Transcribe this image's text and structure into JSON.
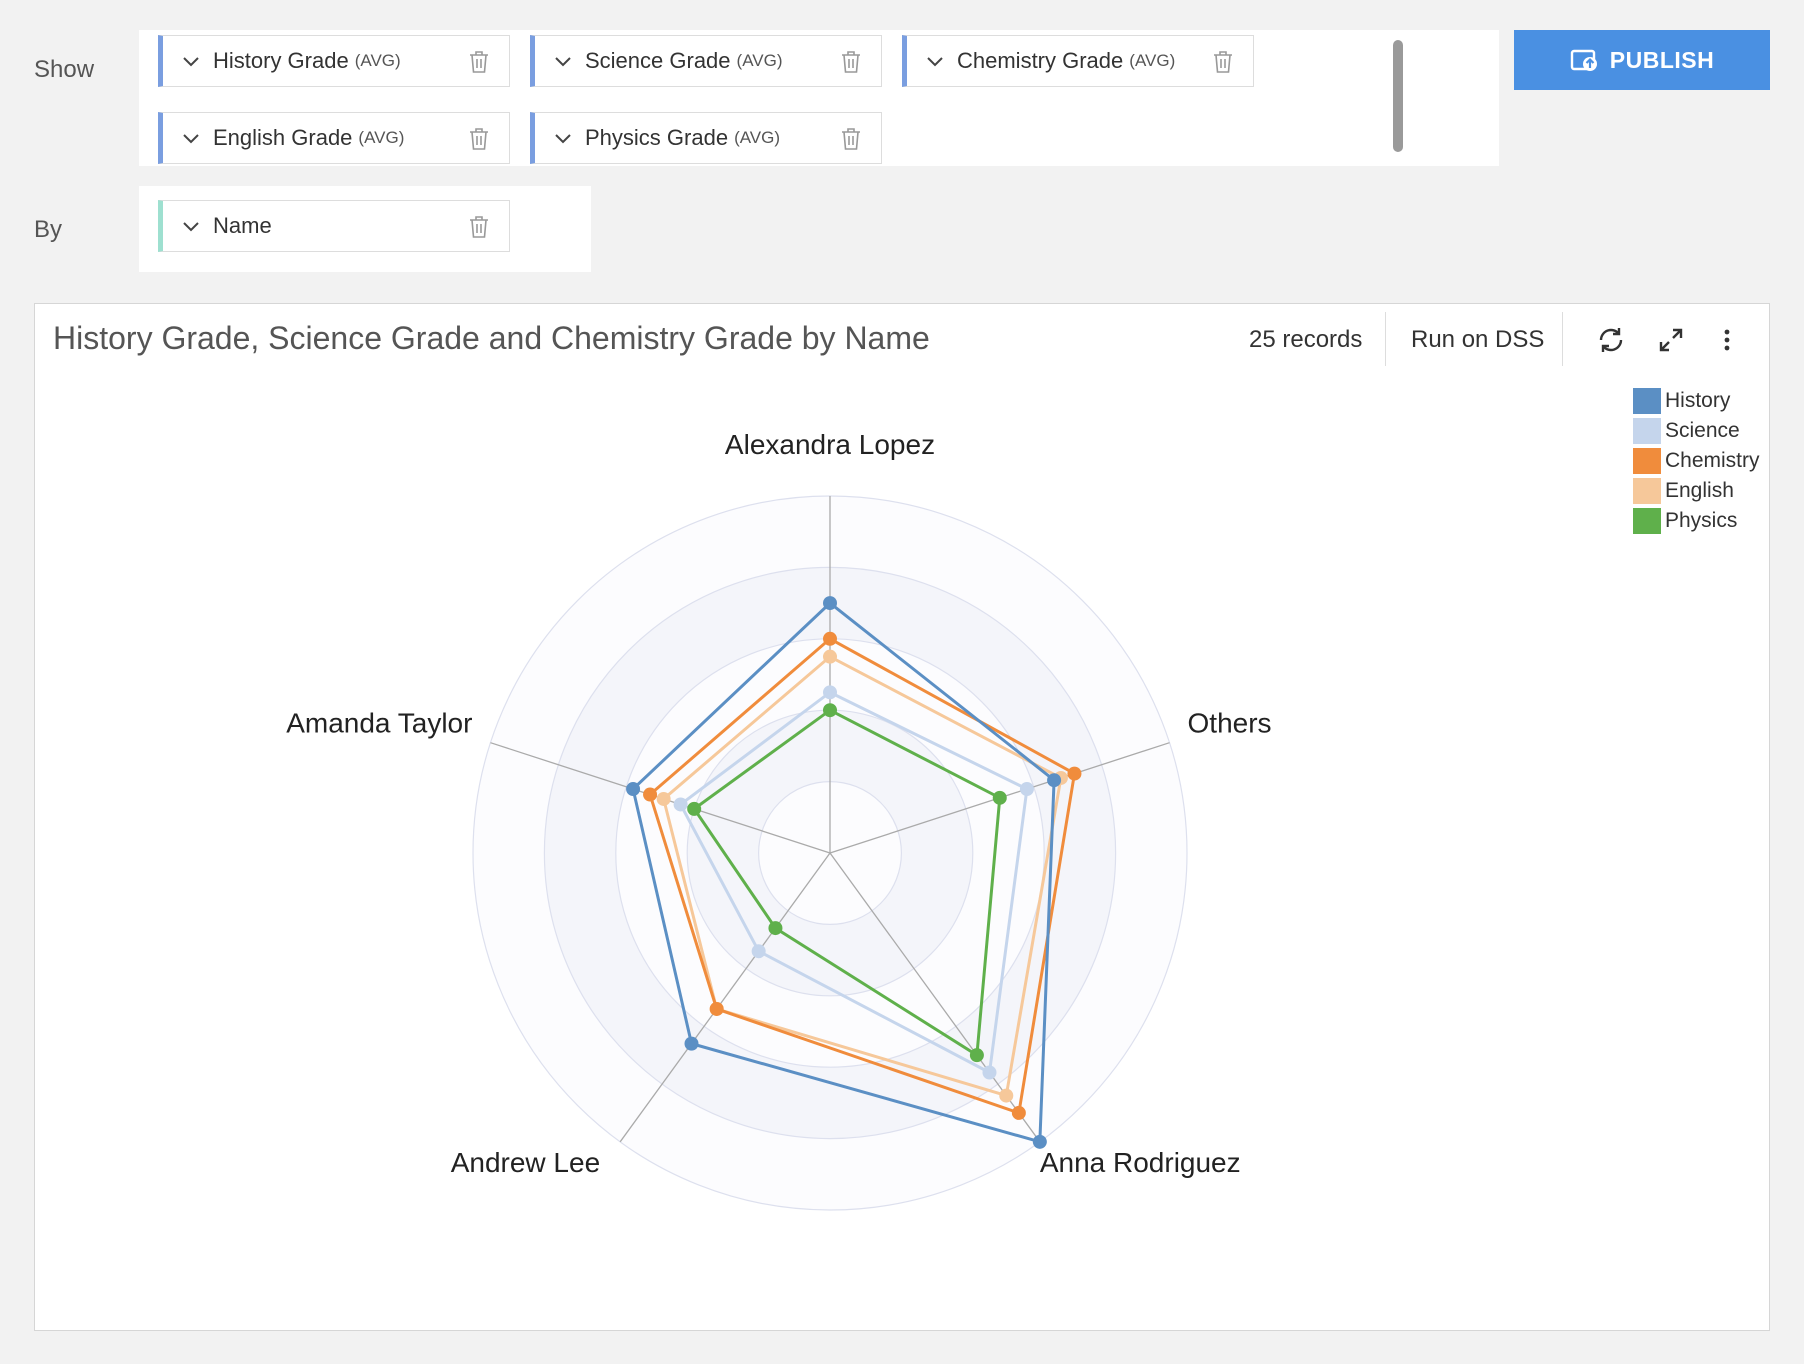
{
  "header": {
    "show_label": "Show",
    "by_label": "By",
    "publish_label": "PUBLISH"
  },
  "show_pills": [
    {
      "label": "History Grade",
      "agg": "(AVG)"
    },
    {
      "label": "Science Grade",
      "agg": "(AVG)"
    },
    {
      "label": "Chemistry Grade",
      "agg": "(AVG)"
    },
    {
      "label": "English Grade",
      "agg": "(AVG)"
    },
    {
      "label": "Physics Grade",
      "agg": "(AVG)"
    }
  ],
  "by_pills": [
    {
      "label": "Name"
    }
  ],
  "chart_header": {
    "title": "History Grade, Science Grade and Chemistry Grade by Name",
    "records": "25 records",
    "run_label": "Run on DSS"
  },
  "colors": {
    "accent": "#4a90e2",
    "measure_border": "#7a9ee0",
    "dimension_border": "#9ee0d0"
  },
  "icons": [
    "chevron-down-icon",
    "trash-icon",
    "publish-icon",
    "refresh-icon",
    "expand-icon",
    "more-vert-icon"
  ],
  "chart_data": {
    "type": "radar",
    "categories": [
      "Alexandra Lopez",
      "Others",
      "Anna Rodriguez",
      "Andrew Lee",
      "Amanda Taylor"
    ],
    "max": 100,
    "rings": 5,
    "series": [
      {
        "name": "History",
        "color": "#5b8fc4",
        "values": [
          70,
          66,
          100,
          66,
          58
        ]
      },
      {
        "name": "Science",
        "color": "#c5d5ec",
        "values": [
          45,
          58,
          76,
          34,
          44
        ]
      },
      {
        "name": "Chemistry",
        "color": "#f08c3c",
        "values": [
          60,
          72,
          90,
          54,
          53
        ]
      },
      {
        "name": "English",
        "color": "#f6c89a",
        "values": [
          55,
          68,
          84,
          54,
          49
        ]
      },
      {
        "name": "Physics",
        "color": "#5fb04b",
        "values": [
          40,
          50,
          70,
          26,
          40
        ]
      }
    ],
    "legend_position": "top-right"
  }
}
